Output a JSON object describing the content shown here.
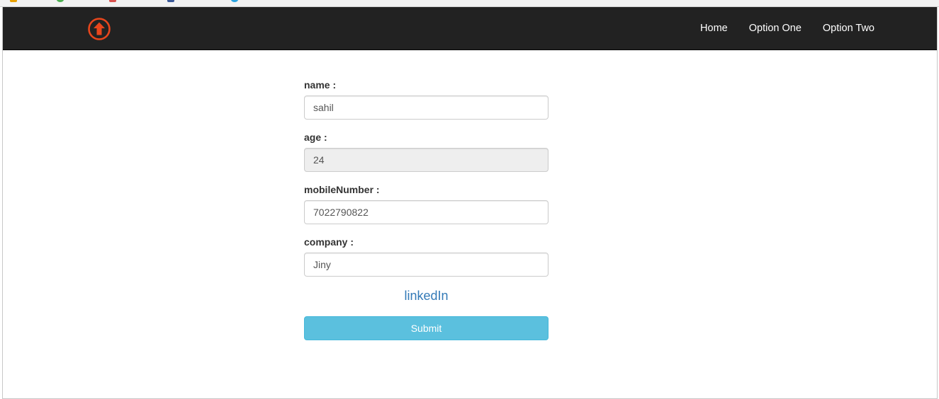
{
  "colors": {
    "navbar_bg": "#222222",
    "brand_icon": "#e8461c",
    "link": "#337ab7",
    "button_info": "#5bc0de"
  },
  "navbar": {
    "brand_icon": "arrow-up-circle-icon",
    "links": [
      "Home",
      "Option One",
      "Option Two"
    ]
  },
  "form": {
    "fields": [
      {
        "label": "name :",
        "value": "sahil",
        "readonly": false
      },
      {
        "label": "age :",
        "value": "24",
        "readonly": true
      },
      {
        "label": "mobileNumber :",
        "value": "7022790822",
        "readonly": false
      },
      {
        "label": "company :",
        "value": "Jiny",
        "readonly": false
      }
    ],
    "link_label": "linkedIn",
    "submit_label": "Submit"
  }
}
